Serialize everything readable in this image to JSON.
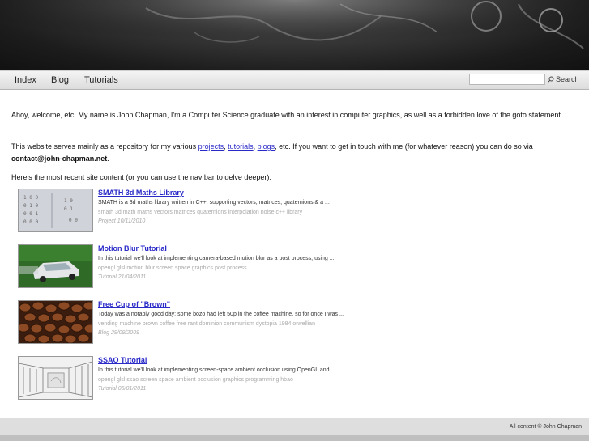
{
  "nav": {
    "items": [
      {
        "label": "Index"
      },
      {
        "label": "Blog"
      },
      {
        "label": "Tutorials"
      }
    ],
    "search_value": "",
    "search_button": "Search"
  },
  "intro": {
    "p1": "Ahoy, welcome, etc. My name is John Chapman, I'm a Computer Science graduate with an interest in computer graphics, as well as a forbidden love of the goto statement.",
    "p2_before": "This website serves mainly as a repository for my various ",
    "link_projects": "projects",
    "sep1": ", ",
    "link_tutorials": "tutorials",
    "sep2": ", ",
    "link_blogs": "blogs",
    "p2_after": ", etc. If you want to get in touch with me (for whatever reason) you can do so via ",
    "email": "contact@john-chapman.net",
    "p2_end": ".",
    "p3": "Here's the most recent site content (or you can use the nav bar to delve deeper):"
  },
  "items": [
    {
      "title": "SMATH 3d Maths Library",
      "desc": "SMATH is a 3d maths library written in C++, supporting vectors, matrices, quaternions & a ...",
      "tags": "smath 3d math maths vectors matrices quaternions interpolation noise c++ library",
      "date": "Project 10/11/2010",
      "thumb_icon": "matrix-thumbnail"
    },
    {
      "title": "Motion Blur Tutorial",
      "desc": "In this tutorial we'll look at implementing camera-based motion blur as a post process, using ...",
      "tags": "opengl glsl motion blur screen space graphics post process",
      "date": "Tutorial 21/04/2011",
      "thumb_icon": "car-thumbnail"
    },
    {
      "title": "Free Cup of \"Brown\"",
      "desc": "Today was a notably good day; some bozo had left 50p in the coffee machine, so for once I was ...",
      "tags": "vending machine brown coffee free rant dominion communism dystopia 1984 orwellian",
      "date": "Blog 29/09/2009",
      "thumb_icon": "coffee-beans-thumbnail"
    },
    {
      "title": "SSAO Tutorial",
      "desc": "In this tutorial we'll look at implementing screen-space ambient occlusion using OpenGL and ...",
      "tags": "opengl glsl ssao screen space ambient occlusion graphics programming hbao",
      "date": "Tutorial 05/01/2011",
      "thumb_icon": "ssao-room-thumbnail"
    }
  ],
  "footer": {
    "text": "All content © John Chapman"
  }
}
